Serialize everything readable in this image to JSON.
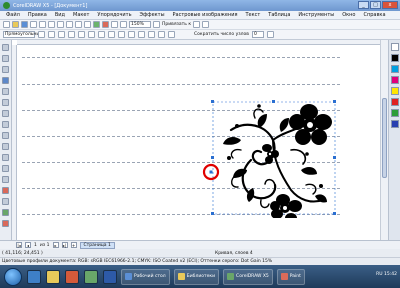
{
  "window": {
    "title": "CorelDRAW X5 - [Документ1]",
    "buttons": [
      "_",
      "□",
      "x"
    ]
  },
  "menu": {
    "items": [
      "Файл",
      "Правка",
      "Вид",
      "Макет",
      "Упорядочить",
      "Эффекты",
      "Растровые изображения",
      "Текст",
      "Таблица",
      "Инструменты",
      "Окно",
      "Справка"
    ]
  },
  "toolbar": {
    "zoom_value": "150%",
    "snap_label": "Привязать к",
    "nudge_label": "Сократить число узлов",
    "nudge_value": "0"
  },
  "property_bar": {
    "preset_label": "Прямоугольник"
  },
  "pages": {
    "current": "1",
    "count_text": "из 1",
    "page_tab": "Страница 1"
  },
  "status": {
    "coords": "( 41,116; 24,451 )",
    "object_info": "Кривая, слоев 4",
    "color_profile": "Цветовые профили документа: RGB: sRGB IEC61966-2.1; CMYK: ISO Coated v2 (ECI); Оттенки серого: Dot Gain 15%"
  },
  "taskbar": {
    "items": [
      {
        "label": "Рабочий стол",
        "color": "#5b8fd6"
      },
      {
        "label": "Библиотеки",
        "color": "#e8c95a"
      },
      {
        "label": "CorelDRAW X5",
        "color": "#69a669"
      },
      {
        "label": "Paint",
        "color": "#d96b5a"
      }
    ],
    "tray_text": "RU 15:42"
  },
  "colors": {
    "highlight_ring": "#e00000",
    "selection_handles": "#2a6fd1"
  }
}
